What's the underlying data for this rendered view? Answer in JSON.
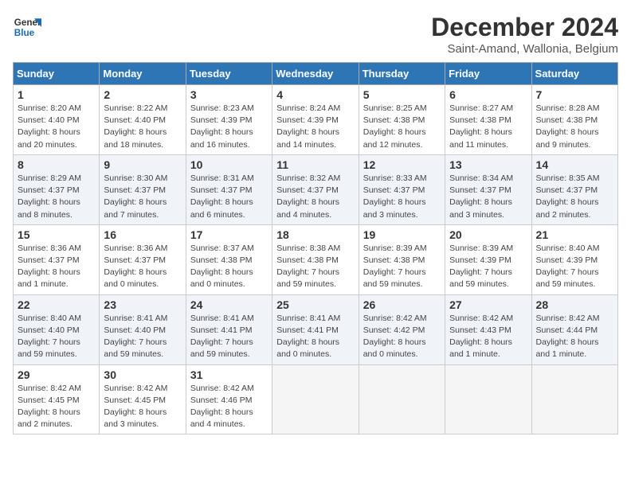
{
  "header": {
    "logo_general": "General",
    "logo_blue": "Blue",
    "month_title": "December 2024",
    "subtitle": "Saint-Amand, Wallonia, Belgium"
  },
  "weekdays": [
    "Sunday",
    "Monday",
    "Tuesday",
    "Wednesday",
    "Thursday",
    "Friday",
    "Saturday"
  ],
  "weeks": [
    [
      {
        "day": "1",
        "sunrise": "Sunrise: 8:20 AM",
        "sunset": "Sunset: 4:40 PM",
        "daylight": "Daylight: 8 hours and 20 minutes."
      },
      {
        "day": "2",
        "sunrise": "Sunrise: 8:22 AM",
        "sunset": "Sunset: 4:40 PM",
        "daylight": "Daylight: 8 hours and 18 minutes."
      },
      {
        "day": "3",
        "sunrise": "Sunrise: 8:23 AM",
        "sunset": "Sunset: 4:39 PM",
        "daylight": "Daylight: 8 hours and 16 minutes."
      },
      {
        "day": "4",
        "sunrise": "Sunrise: 8:24 AM",
        "sunset": "Sunset: 4:39 PM",
        "daylight": "Daylight: 8 hours and 14 minutes."
      },
      {
        "day": "5",
        "sunrise": "Sunrise: 8:25 AM",
        "sunset": "Sunset: 4:38 PM",
        "daylight": "Daylight: 8 hours and 12 minutes."
      },
      {
        "day": "6",
        "sunrise": "Sunrise: 8:27 AM",
        "sunset": "Sunset: 4:38 PM",
        "daylight": "Daylight: 8 hours and 11 minutes."
      },
      {
        "day": "7",
        "sunrise": "Sunrise: 8:28 AM",
        "sunset": "Sunset: 4:38 PM",
        "daylight": "Daylight: 8 hours and 9 minutes."
      }
    ],
    [
      {
        "day": "8",
        "sunrise": "Sunrise: 8:29 AM",
        "sunset": "Sunset: 4:37 PM",
        "daylight": "Daylight: 8 hours and 8 minutes."
      },
      {
        "day": "9",
        "sunrise": "Sunrise: 8:30 AM",
        "sunset": "Sunset: 4:37 PM",
        "daylight": "Daylight: 8 hours and 7 minutes."
      },
      {
        "day": "10",
        "sunrise": "Sunrise: 8:31 AM",
        "sunset": "Sunset: 4:37 PM",
        "daylight": "Daylight: 8 hours and 6 minutes."
      },
      {
        "day": "11",
        "sunrise": "Sunrise: 8:32 AM",
        "sunset": "Sunset: 4:37 PM",
        "daylight": "Daylight: 8 hours and 4 minutes."
      },
      {
        "day": "12",
        "sunrise": "Sunrise: 8:33 AM",
        "sunset": "Sunset: 4:37 PM",
        "daylight": "Daylight: 8 hours and 3 minutes."
      },
      {
        "day": "13",
        "sunrise": "Sunrise: 8:34 AM",
        "sunset": "Sunset: 4:37 PM",
        "daylight": "Daylight: 8 hours and 3 minutes."
      },
      {
        "day": "14",
        "sunrise": "Sunrise: 8:35 AM",
        "sunset": "Sunset: 4:37 PM",
        "daylight": "Daylight: 8 hours and 2 minutes."
      }
    ],
    [
      {
        "day": "15",
        "sunrise": "Sunrise: 8:36 AM",
        "sunset": "Sunset: 4:37 PM",
        "daylight": "Daylight: 8 hours and 1 minute."
      },
      {
        "day": "16",
        "sunrise": "Sunrise: 8:36 AM",
        "sunset": "Sunset: 4:37 PM",
        "daylight": "Daylight: 8 hours and 0 minutes."
      },
      {
        "day": "17",
        "sunrise": "Sunrise: 8:37 AM",
        "sunset": "Sunset: 4:38 PM",
        "daylight": "Daylight: 8 hours and 0 minutes."
      },
      {
        "day": "18",
        "sunrise": "Sunrise: 8:38 AM",
        "sunset": "Sunset: 4:38 PM",
        "daylight": "Daylight: 7 hours and 59 minutes."
      },
      {
        "day": "19",
        "sunrise": "Sunrise: 8:39 AM",
        "sunset": "Sunset: 4:38 PM",
        "daylight": "Daylight: 7 hours and 59 minutes."
      },
      {
        "day": "20",
        "sunrise": "Sunrise: 8:39 AM",
        "sunset": "Sunset: 4:39 PM",
        "daylight": "Daylight: 7 hours and 59 minutes."
      },
      {
        "day": "21",
        "sunrise": "Sunrise: 8:40 AM",
        "sunset": "Sunset: 4:39 PM",
        "daylight": "Daylight: 7 hours and 59 minutes."
      }
    ],
    [
      {
        "day": "22",
        "sunrise": "Sunrise: 8:40 AM",
        "sunset": "Sunset: 4:40 PM",
        "daylight": "Daylight: 7 hours and 59 minutes."
      },
      {
        "day": "23",
        "sunrise": "Sunrise: 8:41 AM",
        "sunset": "Sunset: 4:40 PM",
        "daylight": "Daylight: 7 hours and 59 minutes."
      },
      {
        "day": "24",
        "sunrise": "Sunrise: 8:41 AM",
        "sunset": "Sunset: 4:41 PM",
        "daylight": "Daylight: 7 hours and 59 minutes."
      },
      {
        "day": "25",
        "sunrise": "Sunrise: 8:41 AM",
        "sunset": "Sunset: 4:41 PM",
        "daylight": "Daylight: 8 hours and 0 minutes."
      },
      {
        "day": "26",
        "sunrise": "Sunrise: 8:42 AM",
        "sunset": "Sunset: 4:42 PM",
        "daylight": "Daylight: 8 hours and 0 minutes."
      },
      {
        "day": "27",
        "sunrise": "Sunrise: 8:42 AM",
        "sunset": "Sunset: 4:43 PM",
        "daylight": "Daylight: 8 hours and 1 minute."
      },
      {
        "day": "28",
        "sunrise": "Sunrise: 8:42 AM",
        "sunset": "Sunset: 4:44 PM",
        "daylight": "Daylight: 8 hours and 1 minute."
      }
    ],
    [
      {
        "day": "29",
        "sunrise": "Sunrise: 8:42 AM",
        "sunset": "Sunset: 4:45 PM",
        "daylight": "Daylight: 8 hours and 2 minutes."
      },
      {
        "day": "30",
        "sunrise": "Sunrise: 8:42 AM",
        "sunset": "Sunset: 4:45 PM",
        "daylight": "Daylight: 8 hours and 3 minutes."
      },
      {
        "day": "31",
        "sunrise": "Sunrise: 8:42 AM",
        "sunset": "Sunset: 4:46 PM",
        "daylight": "Daylight: 8 hours and 4 minutes."
      },
      null,
      null,
      null,
      null
    ]
  ]
}
